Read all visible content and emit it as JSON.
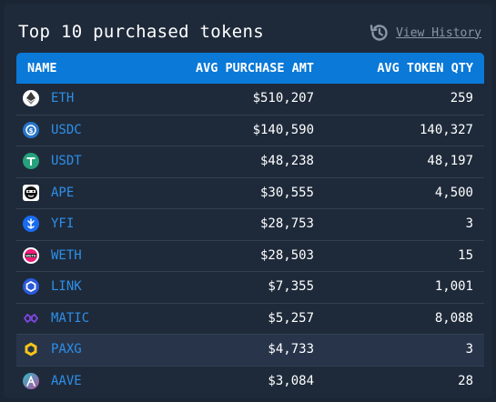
{
  "title": "Top 10 purchased tokens",
  "history_link": "View History",
  "columns": {
    "name": "NAME",
    "amt": "AVG PURCHASE AMT",
    "qty": "AVG TOKEN QTY"
  },
  "colors": {
    "accent": "#0a79d8",
    "symbol": "#2f8fe8",
    "panel": "#1e2a3a"
  },
  "rows": [
    {
      "symbol": "ETH",
      "amt": "$510,207",
      "qty": "259",
      "icon": "eth-icon"
    },
    {
      "symbol": "USDC",
      "amt": "$140,590",
      "qty": "140,327",
      "icon": "usdc-icon"
    },
    {
      "symbol": "USDT",
      "amt": "$48,238",
      "qty": "48,197",
      "icon": "usdt-icon"
    },
    {
      "symbol": "APE",
      "amt": "$30,555",
      "qty": "4,500",
      "icon": "ape-icon"
    },
    {
      "symbol": "YFI",
      "amt": "$28,753",
      "qty": "3",
      "icon": "yfi-icon"
    },
    {
      "symbol": "WETH",
      "amt": "$28,503",
      "qty": "15",
      "icon": "weth-icon"
    },
    {
      "symbol": "LINK",
      "amt": "$7,355",
      "qty": "1,001",
      "icon": "link-icon"
    },
    {
      "symbol": "MATIC",
      "amt": "$5,257",
      "qty": "8,088",
      "icon": "matic-icon"
    },
    {
      "symbol": "PAXG",
      "amt": "$4,733",
      "qty": "3",
      "icon": "paxg-icon"
    },
    {
      "symbol": "AAVE",
      "amt": "$3,084",
      "qty": "28",
      "icon": "aave-icon"
    }
  ]
}
